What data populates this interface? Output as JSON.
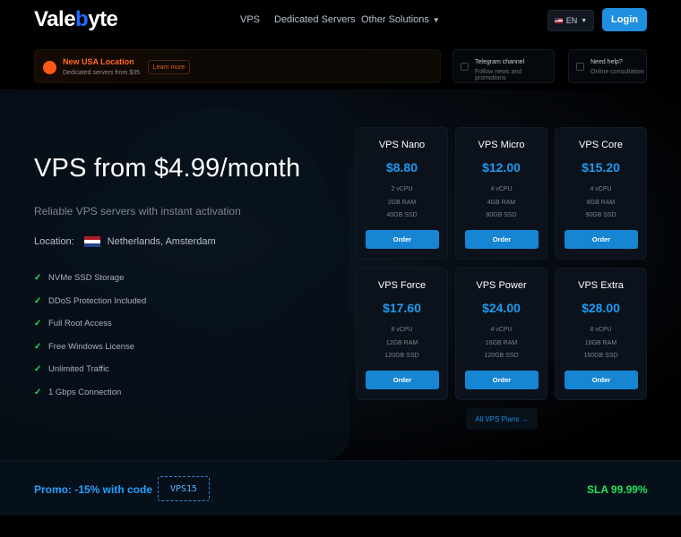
{
  "header": {
    "logo": {
      "part1": "Vale",
      "part2": "b",
      "part3": "yte"
    },
    "nav": [
      {
        "label": "VPS"
      },
      {
        "label": "Dedicated Servers"
      },
      {
        "label": "Other Solutions"
      }
    ],
    "lang": "EN",
    "login": "Login"
  },
  "announcement": {
    "title": "New USA Location",
    "subtitle": "Dedicated servers from $35",
    "button": "Learn more",
    "cards": [
      {
        "title": "Telegram channel",
        "subtitle": "Follow news and promotions"
      },
      {
        "title": "Need help?",
        "subtitle": "Online consultation"
      }
    ]
  },
  "hero": {
    "title": "VPS from $4.99/month",
    "subtitle": "Reliable VPS servers with instant activation",
    "location_label": "Location:",
    "location_value": "Netherlands, Amsterdam",
    "features": [
      "NVMe SSD Storage",
      "DDoS Protection Included",
      "Full Root Access",
      "Free Windows License",
      "Unlimited Traffic",
      "1 Gbps Connection"
    ]
  },
  "plans": [
    {
      "name": "VPS Nano",
      "price": "$8.80",
      "cpu": "2 vCPU",
      "ram": "2GB RAM",
      "ssd": "40GB SSD",
      "order": "Order"
    },
    {
      "name": "VPS Micro",
      "price": "$12.00",
      "cpu": "4 vCPU",
      "ram": "4GB RAM",
      "ssd": "80GB SSD",
      "order": "Order"
    },
    {
      "name": "VPS Core",
      "price": "$15.20",
      "cpu": "4 vCPU",
      "ram": "8GB RAM",
      "ssd": "90GB SSD",
      "order": "Order"
    },
    {
      "name": "VPS Force",
      "price": "$17.60",
      "cpu": "8 vCPU",
      "ram": "12GB RAM",
      "ssd": "120GB SSD",
      "order": "Order"
    },
    {
      "name": "VPS Power",
      "price": "$24.00",
      "cpu": "4 vCPU",
      "ram": "16GB RAM",
      "ssd": "120GB SSD",
      "order": "Order"
    },
    {
      "name": "VPS Extra",
      "price": "$28.00",
      "cpu": "8 vCPU",
      "ram": "18GB RAM",
      "ssd": "160GB SSD",
      "order": "Order"
    }
  ],
  "all_plans": "All VPS Plans →",
  "promo": {
    "text": "Promo: -15% with code",
    "code": "VPS15",
    "sla": "SLA 99.99%"
  },
  "colors": {
    "accent": "#1e9af0",
    "button": "#1685d2",
    "check": "#22e25b",
    "announce": "#ff5a14"
  }
}
